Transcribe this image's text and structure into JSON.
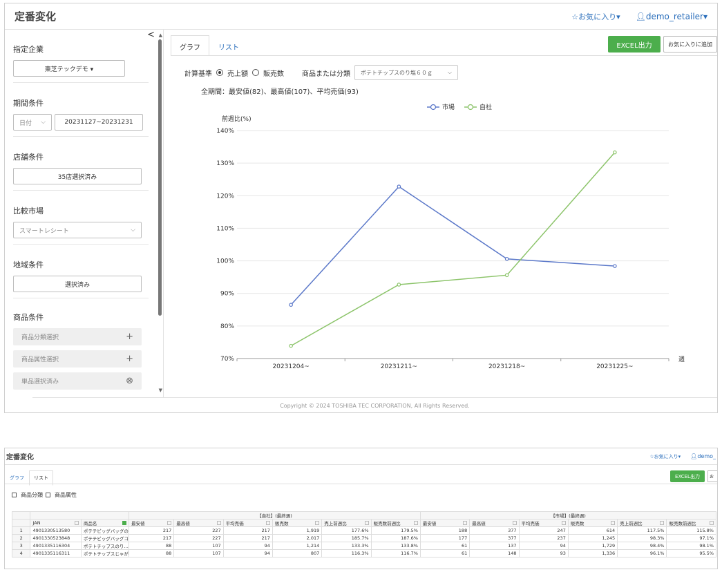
{
  "screen1": {
    "header": {
      "title": "定番変化",
      "favorites": "☆お気に入り▾",
      "user": "demo_retailer▾"
    },
    "sidebar": {
      "collapse_icon": "chevron-left-icon",
      "company": {
        "label": "指定企業",
        "value": "東芝テックデモ ▾"
      },
      "period": {
        "label": "期間条件",
        "type": "日付",
        "range": "20231127~20231231"
      },
      "store": {
        "label": "店舗条件",
        "value": "35店選択済み"
      },
      "market": {
        "label": "比較市場",
        "value": "スマートレシート"
      },
      "region": {
        "label": "地域条件",
        "value": "選択済み"
      },
      "product": {
        "label": "商品条件",
        "items": [
          {
            "label": "商品分類選択",
            "icon": "+"
          },
          {
            "label": "商品属性選択",
            "icon": "+"
          },
          {
            "label": "単品選択済み",
            "icon": "⊗"
          }
        ]
      }
    },
    "tabs": [
      "グラフ",
      "リスト"
    ],
    "excel_button": "EXCEL出力",
    "fav_button": "お気に入りに追加",
    "calc": {
      "label": "計算基準",
      "option1": "売上額",
      "option2": "販売数",
      "product_label": "商品または分類",
      "product_value": "ポテトチップスのり塩６０ｇ"
    },
    "summary": "全期間：最安値(82)、最高値(107)、平均売価(93)",
    "footer": "Copyright © 2024 TOSHIBA TEC CORPORATION, All Rights Reserved."
  },
  "chart_data": {
    "type": "line",
    "categories": [
      "20231204~",
      "20231211~",
      "20231218~",
      "20231225~"
    ],
    "series": [
      {
        "name": "市場",
        "color": "#5b78c9",
        "values": [
          86.5,
          122.8,
          100.6,
          98.4
        ]
      },
      {
        "name": "自社",
        "color": "#8cc46a",
        "values": [
          73.9,
          92.7,
          95.6,
          133.3
        ]
      }
    ],
    "ylabel": "前週比(%)",
    "xlabel": "週",
    "ylim": [
      70,
      140
    ],
    "yticks": [
      "70%",
      "80%",
      "90%",
      "100%",
      "110%",
      "120%",
      "130%",
      "140%"
    ],
    "grid": true,
    "legend": "top-center"
  },
  "screen2": {
    "header": {
      "title": "定番変化",
      "favorites": "☆お気に入り▾",
      "user": "demo_"
    },
    "tabs": [
      "グラフ",
      "リスト"
    ],
    "excel_button": "EXCEL出力",
    "fav_button": "お",
    "checks": [
      "商品分類",
      "商品属性"
    ],
    "group_own": "【自社】(最終週)",
    "group_market": "【市場】(最終週)",
    "columns": [
      "JAN",
      "商品名",
      "最安値",
      "最高値",
      "平均売価",
      "販売数",
      "売上前週比",
      "販売数前週比",
      "最安値",
      "最高値",
      "平均売価",
      "販売数",
      "売上前週比",
      "販売数前週比"
    ],
    "rows": [
      [
        "1",
        "4901330513580",
        "ポテチビッグバッグの…",
        "217",
        "227",
        "217",
        "1,919",
        "177.6%",
        "179.5%",
        "188",
        "377",
        "247",
        "614",
        "117.5%",
        "115.8%"
      ],
      [
        "2",
        "4901330523848",
        "ポテチビッグバッグコ…",
        "217",
        "227",
        "217",
        "2,017",
        "185.7%",
        "187.6%",
        "177",
        "377",
        "237",
        "1,245",
        "98.3%",
        "97.1%"
      ],
      [
        "3",
        "4901335116304",
        "ポテトチップスのり…",
        "88",
        "107",
        "94",
        "1,214",
        "133.3%",
        "133.8%",
        "61",
        "137",
        "94",
        "1,729",
        "98.4%",
        "98.1%"
      ],
      [
        "4",
        "4901335116311",
        "ポテトチップスじゃが…",
        "88",
        "107",
        "94",
        "807",
        "116.3%",
        "116.7%",
        "61",
        "148",
        "93",
        "1,336",
        "96.1%",
        "95.5%"
      ]
    ]
  }
}
